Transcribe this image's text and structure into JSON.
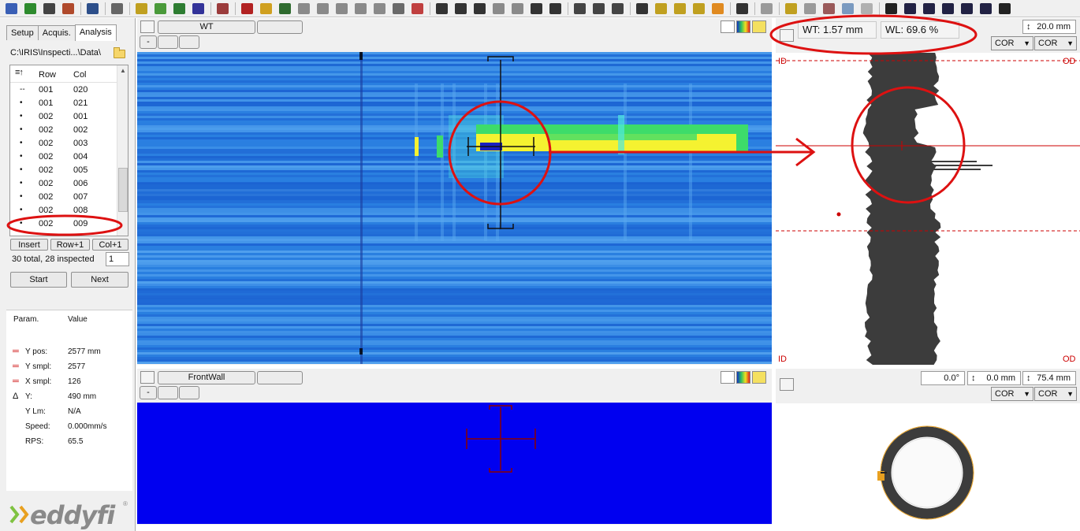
{
  "toolbar": {
    "icons": [
      {
        "name": "list-settings-icon",
        "color": "#3a5fb5"
      },
      {
        "name": "probe-icon",
        "color": "#2e8b2e"
      },
      {
        "name": "printer-icon",
        "color": "#444444"
      },
      {
        "name": "grid-cross-icon",
        "color": "#b04a2c"
      },
      {
        "name": "sep"
      },
      {
        "name": "save-icon",
        "color": "#2d4f8a"
      },
      {
        "name": "sep"
      },
      {
        "name": "link-icon",
        "color": "#666666"
      },
      {
        "name": "sep"
      },
      {
        "name": "wand-icon",
        "color": "#c0a020"
      },
      {
        "name": "battery-icon",
        "color": "#4a9a3a"
      },
      {
        "name": "layers-icon",
        "color": "#2e7d32"
      },
      {
        "name": "zero-icon",
        "color": "#333399"
      },
      {
        "name": "sep"
      },
      {
        "name": "magic-wand-icon",
        "color": "#9b3c3c"
      },
      {
        "name": "sep"
      },
      {
        "name": "pen-red-icon",
        "color": "#b22222"
      },
      {
        "name": "pen-yellow-icon",
        "color": "#d0a020"
      },
      {
        "name": "crosshair-icon",
        "color": "#2f6b2f"
      },
      {
        "name": "gauge-icon",
        "color": "#8a8a8a"
      },
      {
        "name": "funnel-icon",
        "color": "#8a8a8a"
      },
      {
        "name": "target-icon",
        "color": "#8a8a8a"
      },
      {
        "name": "letter-a-icon",
        "color": "#8a8a8a"
      },
      {
        "name": "angle-icon",
        "color": "#8a8a8a"
      },
      {
        "name": "clipboard-icon",
        "color": "#6a6a6a"
      },
      {
        "name": "palette-icon",
        "color": "#c04040"
      },
      {
        "name": "sep"
      },
      {
        "name": "arrows-icon",
        "color": "#333333"
      },
      {
        "name": "move-icon",
        "color": "#333333"
      },
      {
        "name": "scale-icon",
        "color": "#333333"
      },
      {
        "name": "marker1-icon",
        "color": "#8a8a8a"
      },
      {
        "name": "marker2-icon",
        "color": "#8a8a8a"
      },
      {
        "name": "camera-icon",
        "color": "#333333"
      },
      {
        "name": "camera-multi-icon",
        "color": "#333333"
      },
      {
        "name": "sep"
      },
      {
        "name": "document-icon",
        "color": "#444444"
      },
      {
        "name": "document2-icon",
        "color": "#444444"
      },
      {
        "name": "ruler-icon",
        "color": "#444444"
      },
      {
        "name": "sep"
      },
      {
        "name": "balance-icon",
        "color": "#333333"
      },
      {
        "name": "sparkle-icon",
        "color": "#c0a020"
      },
      {
        "name": "sparkle2-icon",
        "color": "#c0a020"
      },
      {
        "name": "sparkle3-icon",
        "color": "#c0a020"
      },
      {
        "name": "arrow-orange-icon",
        "color": "#e08a20"
      },
      {
        "name": "sep"
      },
      {
        "name": "monitor-icon",
        "color": "#333333"
      },
      {
        "name": "sep"
      },
      {
        "name": "pen-gray-icon",
        "color": "#9a9a9a"
      },
      {
        "name": "sep"
      },
      {
        "name": "hammer-icon",
        "color": "#c0a020"
      },
      {
        "name": "blob-icon",
        "color": "#9a9a9a"
      },
      {
        "name": "bug-icon",
        "color": "#9a5a5a"
      },
      {
        "name": "lamp-icon",
        "color": "#7a9ac0"
      },
      {
        "name": "square-gray-icon",
        "color": "#b0b0b0"
      },
      {
        "name": "sep"
      },
      {
        "name": "play-icon",
        "color": "#222222"
      },
      {
        "name": "layout-split-h-icon",
        "color": "#222244"
      },
      {
        "name": "layout-bars-icon",
        "color": "#222244"
      },
      {
        "name": "layout-cols-icon",
        "color": "#222244"
      },
      {
        "name": "layout-split-v-icon",
        "color": "#222244"
      },
      {
        "name": "layout-grid-icon",
        "color": "#222244"
      },
      {
        "name": "close-x-icon",
        "color": "#222222"
      }
    ]
  },
  "left": {
    "tabs": [
      "Setup",
      "Acquis.",
      "Analysis"
    ],
    "path": "C:\\IRIS\\Inspecti...\\Data\\",
    "list_header": {
      "row": "Row",
      "col": "Col"
    },
    "rows": [
      {
        "marker": "--",
        "row": "001",
        "col": "020"
      },
      {
        "marker": "•",
        "row": "001",
        "col": "021"
      },
      {
        "marker": "•",
        "row": "002",
        "col": "001"
      },
      {
        "marker": "•",
        "row": "002",
        "col": "002"
      },
      {
        "marker": "•",
        "row": "002",
        "col": "003"
      },
      {
        "marker": "•",
        "row": "002",
        "col": "004"
      },
      {
        "marker": "•",
        "row": "002",
        "col": "005"
      },
      {
        "marker": "•",
        "row": "002",
        "col": "006"
      },
      {
        "marker": "•",
        "row": "002",
        "col": "007"
      },
      {
        "marker": "•",
        "row": "002",
        "col": "008"
      },
      {
        "marker": "•",
        "row": "002",
        "col": "009"
      }
    ],
    "buttons": {
      "insert": "Insert",
      "row_plus": "Row+1",
      "col_plus": "Col+1",
      "start": "Start",
      "next": "Next"
    },
    "status": "30 total, 28 inspected",
    "step_value": "1",
    "params_header": {
      "param": "Param.",
      "value": "Value"
    },
    "params": [
      {
        "icon": "red-eq",
        "name": "Y pos:",
        "value": "2577 mm"
      },
      {
        "icon": "red-eq",
        "name": "Y smpl:",
        "value": "2577"
      },
      {
        "icon": "red-eq",
        "name": "X smpl:",
        "value": "126"
      },
      {
        "icon": "delta",
        "name": "Y:",
        "value": "490 mm"
      },
      {
        "icon": "",
        "name": "Y Lm:",
        "value": "N/A"
      },
      {
        "icon": "",
        "name": "Speed:",
        "value": "0.000mm/s"
      },
      {
        "icon": "",
        "name": "RPS:",
        "value": "65.5"
      }
    ],
    "logo": "eddyfi",
    "logo_reg": "®"
  },
  "cscan": {
    "title": "WT",
    "minus_label": "-",
    "colors": {
      "bg": "#2a7fe0",
      "deep": "#1a5fd0",
      "light": "#5aa8f0",
      "indication_yellow": "#f5f230",
      "indication_green": "#3ddc6a",
      "indication_cyan": "#4ee8e0",
      "defect": "#1a20c0",
      "cursor": "#111111"
    }
  },
  "frontwall": {
    "title": "FrontWall",
    "minus_label": "-",
    "colors": {
      "bg": "#0000f0",
      "cursor": "#8b0000"
    }
  },
  "profile": {
    "wt_label": "WT: 1.57 mm",
    "wl_label": "WL: 69.6 %",
    "range": "20.0 mm",
    "sel1": "COR",
    "sel2": "COR",
    "id_top": "ID",
    "od_top": "OD",
    "id_bottom": "ID",
    "od_bottom": "OD",
    "colors": {
      "wall": "#3c3c3c",
      "cursor": "#cc0000"
    }
  },
  "polar": {
    "angle": "0.0°",
    "offset": "0.0 mm",
    "size": "75.4 mm",
    "sel1": "COR",
    "sel2": "COR",
    "colors": {
      "ring": "#3c3c3c",
      "accent": "#e8a020"
    }
  },
  "annotations": {
    "color": "#dd1111"
  }
}
